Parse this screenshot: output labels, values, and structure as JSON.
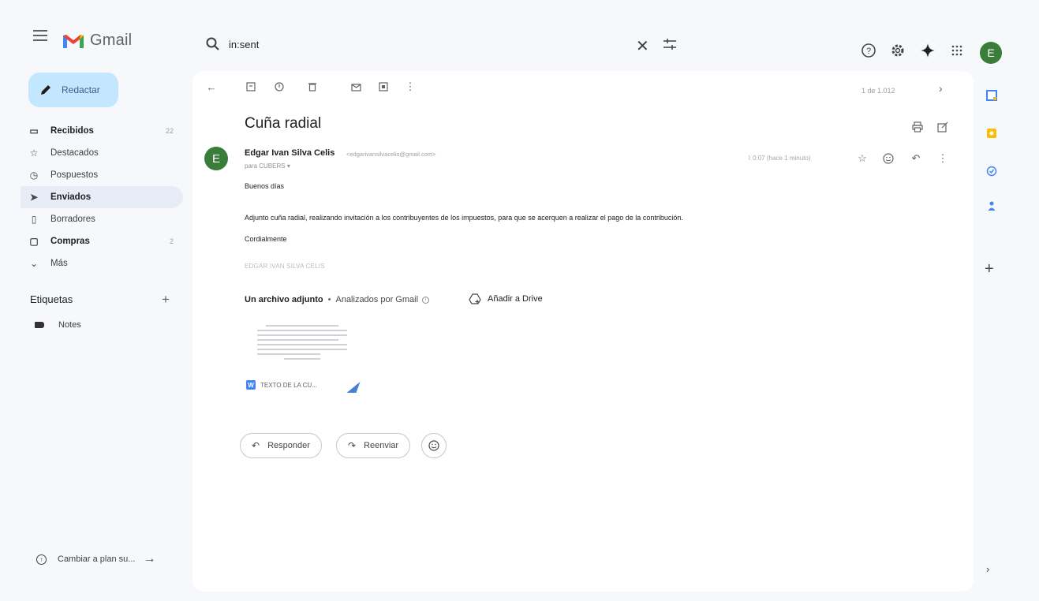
{
  "app": {
    "name": "Gmail"
  },
  "search": {
    "query": "in:sent"
  },
  "compose": {
    "label": "Redactar"
  },
  "nav": [
    {
      "label": "Recibidos",
      "count": "22",
      "icon": "inbox-icon",
      "glyph": "▭",
      "style": "bold"
    },
    {
      "label": "Destacados",
      "count": "",
      "icon": "star-icon",
      "glyph": "☆",
      "style": ""
    },
    {
      "label": "Pospuestos",
      "count": "",
      "icon": "clock-icon",
      "glyph": "◷",
      "style": ""
    },
    {
      "label": "Enviados",
      "count": "",
      "icon": "send-icon",
      "glyph": "➤",
      "style": "active"
    },
    {
      "label": "Borradores",
      "count": "",
      "icon": "draft-icon",
      "glyph": "▯",
      "style": ""
    },
    {
      "label": "Compras",
      "count": "2",
      "icon": "shopping-icon",
      "glyph": "▢",
      "style": "bold"
    },
    {
      "label": "Más",
      "count": "",
      "icon": "chevron-down-icon",
      "glyph": "⌄",
      "style": ""
    }
  ],
  "labels": {
    "heading": "Etiquetas",
    "items": [
      "Notes"
    ]
  },
  "upgrade": {
    "label": "Cambiar a plan su..."
  },
  "toolbar": {
    "pager": "1 de 1.012"
  },
  "email": {
    "subject": "Cuña radial",
    "sender_name": "Edgar Ivan Silva Celis",
    "sender_email": "<edgarivansilvacelis@gmail.com>",
    "to": "para CUBERS",
    "time": "0:07 (hace 1 minuto)",
    "avatar_letter": "E",
    "greeting": "Buenos días",
    "body": "Adjunto cuña radial, realizando invitación a los contribuyentes de los impuestos, para que se acerquen a realizar el pago de la contribución.",
    "closing": "Cordialmente",
    "signature": "EDGAR IVAN SILVA CELIS"
  },
  "attachments": {
    "heading": "Un archivo adjunto",
    "scanned": "Analizados por Gmail",
    "add_drive": "Añadir a Drive",
    "file_name": "TEXTO DE LA CU..."
  },
  "actions": {
    "reply": "Responder",
    "forward": "Reenviar"
  },
  "account": {
    "avatar_letter": "E"
  },
  "colors": {
    "avatar": "#3a7d3a",
    "compose_bg": "#c2e7ff",
    "word_badge": "#4285f4"
  }
}
